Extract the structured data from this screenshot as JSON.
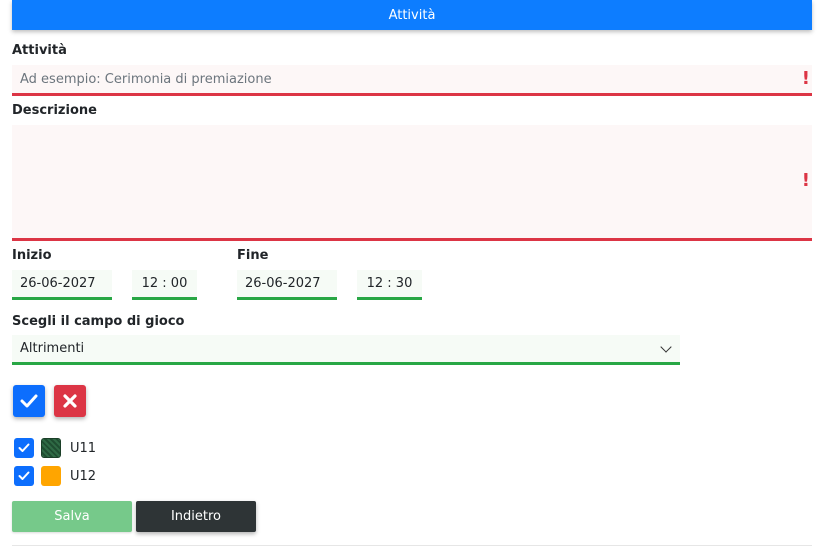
{
  "header": {
    "title": "Attività"
  },
  "form": {
    "activity": {
      "label": "Attività",
      "placeholder": "Ad esempio: Cerimonia di premiazione",
      "value": "",
      "error_mark": "!"
    },
    "description": {
      "label": "Descrizione",
      "value": "",
      "error_mark": "!"
    },
    "start": {
      "label": "Inizio",
      "date": "26-06-2027",
      "time": "12 : 00"
    },
    "end": {
      "label": "Fine",
      "date": "26-06-2027",
      "time": "12 : 30"
    },
    "field": {
      "label": "Scegli il campo di gioco",
      "selected": "Altrimenti"
    }
  },
  "teams": [
    {
      "label": "U11",
      "checked": true,
      "color": "#1f4d31"
    },
    {
      "label": "U12",
      "checked": true,
      "color": "#ffa500"
    }
  ],
  "buttons": {
    "save": "Salva",
    "back": "Indietro"
  },
  "colors": {
    "primary": "#0d7dff",
    "danger": "#dc3545",
    "success": "#28a745",
    "dark": "#2e3436"
  }
}
